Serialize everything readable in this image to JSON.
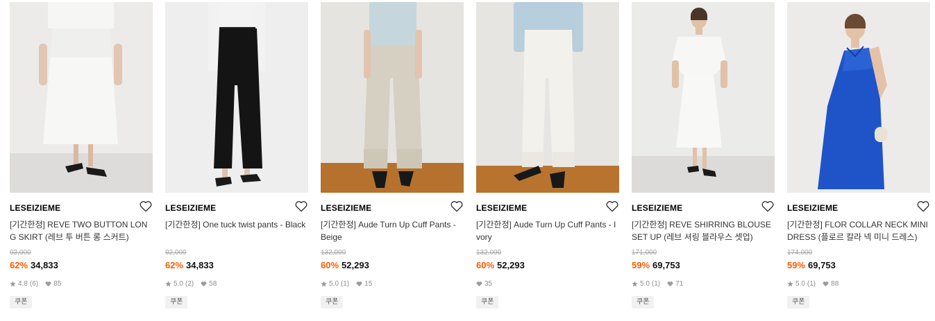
{
  "products": [
    {
      "brand": "LESEIZIEME",
      "title": "[기간한정] REVE TWO BUTTON LONG SKIRT (레브 투 버튼 롱 스커트)",
      "original_price": "93,000",
      "discount": "62%",
      "price": "34,833",
      "rating": "4.8",
      "reviews": "(6)",
      "likes": "85",
      "coupon": "쿠폰"
    },
    {
      "brand": "LESEIZIEME",
      "title": "[기간한정] One tuck twist pants - Black",
      "original_price": "92,000",
      "discount": "62%",
      "price": "34,833",
      "rating": "5.0",
      "reviews": "(2)",
      "likes": "58",
      "coupon": "쿠폰"
    },
    {
      "brand": "LESEIZIEME",
      "title": "[기간한정] Aude Turn Up Cuff Pants - Beige",
      "original_price": "132,000",
      "discount": "60%",
      "price": "52,293",
      "rating": "5.0",
      "reviews": "(1)",
      "likes": "15",
      "coupon": "쿠폰"
    },
    {
      "brand": "LESEIZIEME",
      "title": "[기간한정] Aude Turn Up Cuff Pants - Ivory",
      "original_price": "132,000",
      "discount": "60%",
      "price": "52,293",
      "rating": "",
      "reviews": "",
      "likes": "35",
      "coupon": "쿠폰"
    },
    {
      "brand": "LESEIZIEME",
      "title": "[기간한정] REVE SHIRRING BLOUSE SET UP (레브 셔링 블라우스 셋업)",
      "original_price": "171,000",
      "discount": "59%",
      "price": "69,753",
      "rating": "5.0",
      "reviews": "(1)",
      "likes": "71",
      "coupon": "쿠폰"
    },
    {
      "brand": "LESEIZIEME",
      "title": "[기간한정] FLOR COLLAR NECK MINI DRESS (플로르 칼라 넥 미니 드레스)",
      "original_price": "174,000",
      "discount": "59%",
      "price": "69,753",
      "rating": "5.0",
      "reviews": "(1)",
      "likes": "88",
      "coupon": "쿠폰"
    }
  ],
  "colors": {
    "discount": "#ff5a00",
    "muted": "#8c8c8c",
    "strike": "#a3a3a3"
  },
  "icons": {
    "wishlist": "heart-outline-icon",
    "rating": "star-icon",
    "likes": "heart-filled-icon"
  }
}
